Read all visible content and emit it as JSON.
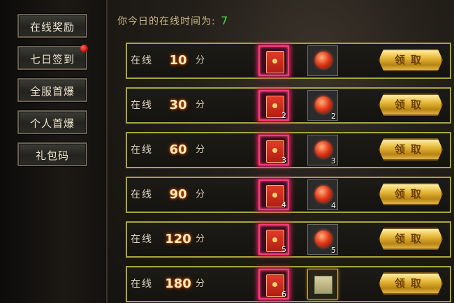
{
  "sidebar": {
    "items": [
      {
        "label": "在线奖励"
      },
      {
        "label": "七日签到"
      },
      {
        "label": "全服首爆"
      },
      {
        "label": "个人首爆"
      },
      {
        "label": "礼包码"
      }
    ]
  },
  "header": {
    "label": "你今日的在线时间为:",
    "value": "7"
  },
  "rows": [
    {
      "label": "在线",
      "minutes": "10",
      "unit": "分",
      "envelope_count": "",
      "item_count": "",
      "item_icon": "red-orb-icon",
      "claim_label": "领取"
    },
    {
      "label": "在线",
      "minutes": "30",
      "unit": "分",
      "envelope_count": "2",
      "item_count": "2",
      "item_icon": "red-orb-icon",
      "claim_label": "领取"
    },
    {
      "label": "在线",
      "minutes": "60",
      "unit": "分",
      "envelope_count": "3",
      "item_count": "3",
      "item_icon": "red-orb-icon",
      "claim_label": "领取"
    },
    {
      "label": "在线",
      "minutes": "90",
      "unit": "分",
      "envelope_count": "4",
      "item_count": "4",
      "item_icon": "red-orb-icon",
      "claim_label": "领取"
    },
    {
      "label": "在线",
      "minutes": "120",
      "unit": "分",
      "envelope_count": "5",
      "item_count": "5",
      "item_icon": "red-orb-icon",
      "claim_label": "领取"
    },
    {
      "label": "在线",
      "minutes": "180",
      "unit": "分",
      "envelope_count": "6",
      "item_count": "",
      "item_icon": "scroll-icon",
      "claim_label": "领取"
    }
  ],
  "colors": {
    "row_border": "#a9a63c",
    "envelope_glow": "#ff3a7a",
    "online_time_value": "#3ee03e",
    "claim_button": "#e5b737",
    "notification_dot": "#c80f0f"
  }
}
